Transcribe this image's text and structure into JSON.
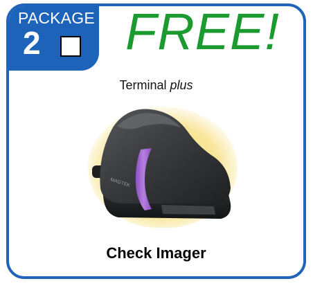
{
  "package": {
    "label": "PACKAGE",
    "number": "2"
  },
  "promo": {
    "text": "FREE!"
  },
  "subtitle": {
    "main": "Terminal",
    "em": "plus"
  },
  "product": {
    "name": "Check Imager",
    "brand": "MAGTEK"
  },
  "colors": {
    "border": "#1f64b8",
    "tab": "#1d63b9",
    "promo": "#1b9a2f",
    "accent_stripe": "#a46ad0",
    "glow": "#f3d24a",
    "device_body": "#3a3b3e"
  }
}
